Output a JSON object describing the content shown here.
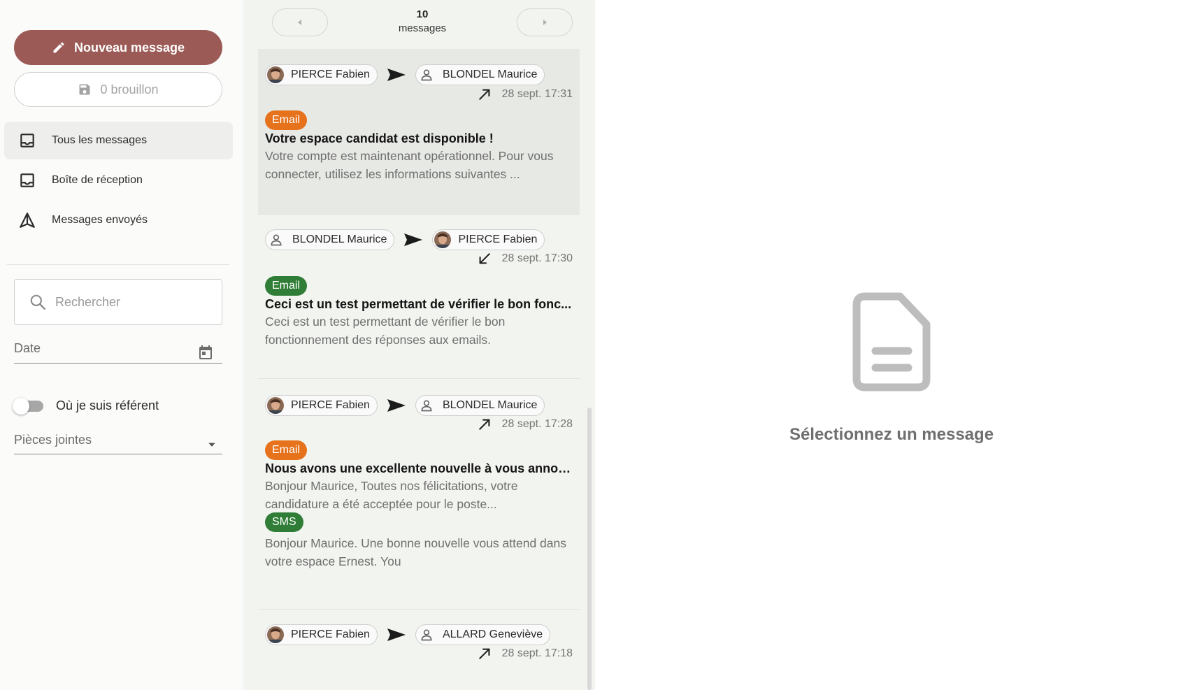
{
  "sidebar": {
    "new_message_label": "Nouveau message",
    "draft_label": "0 brouillon",
    "nav": [
      {
        "label": "Tous les messages"
      },
      {
        "label": "Boîte de réception"
      },
      {
        "label": "Messages envoyés"
      }
    ],
    "search": {
      "placeholder": "Rechercher"
    },
    "date_label": "Date",
    "referent_toggle_label": "Où je suis référent",
    "attachments_label": "Pièces jointes"
  },
  "pager": {
    "count": "10",
    "count_label": "messages"
  },
  "messages": [
    {
      "from": "PIERCE Fabien",
      "to": "BLONDEL Maurice",
      "date": "28 sept. 17:31",
      "channel": "Email",
      "subject": "Votre espace candidat est disponible !",
      "excerpt": "Votre compte est maintenant opérationnel. Pour vous connecter, utilisez les informations suivantes ..."
    },
    {
      "from": "BLONDEL Maurice",
      "to": "PIERCE Fabien",
      "date": "28 sept. 17:30",
      "channel": "Email",
      "subject": "Ceci est un test permettant de vérifier le bon fonc...",
      "excerpt": "Ceci est un test permettant de vérifier le bon fonctionnement des réponses aux emails."
    },
    {
      "from": "PIERCE Fabien",
      "to": "BLONDEL Maurice",
      "date": "28 sept. 17:28",
      "channel": "Email",
      "subject": "Nous avons une excellente nouvelle à vous annon...",
      "excerpt": "Bonjour Maurice, Toutes nos félicitations, votre candidature a été acceptée pour le poste...",
      "sms_channel": "SMS",
      "sms_excerpt": "Bonjour Maurice. Une bonne nouvelle vous attend dans votre espace Ernest. You"
    },
    {
      "from": "PIERCE Fabien",
      "to": "ALLARD Geneviève",
      "date": "28 sept. 17:18"
    }
  ],
  "empty_state": {
    "text": "Sélectionnez un message"
  },
  "colors": {
    "primary": "#9b5a55",
    "email_outgoing_badge": "#e6721c",
    "email_incoming_badge": "#2f7d36",
    "sms_badge": "#2f7d36",
    "list_background": "#f2f4ef"
  }
}
